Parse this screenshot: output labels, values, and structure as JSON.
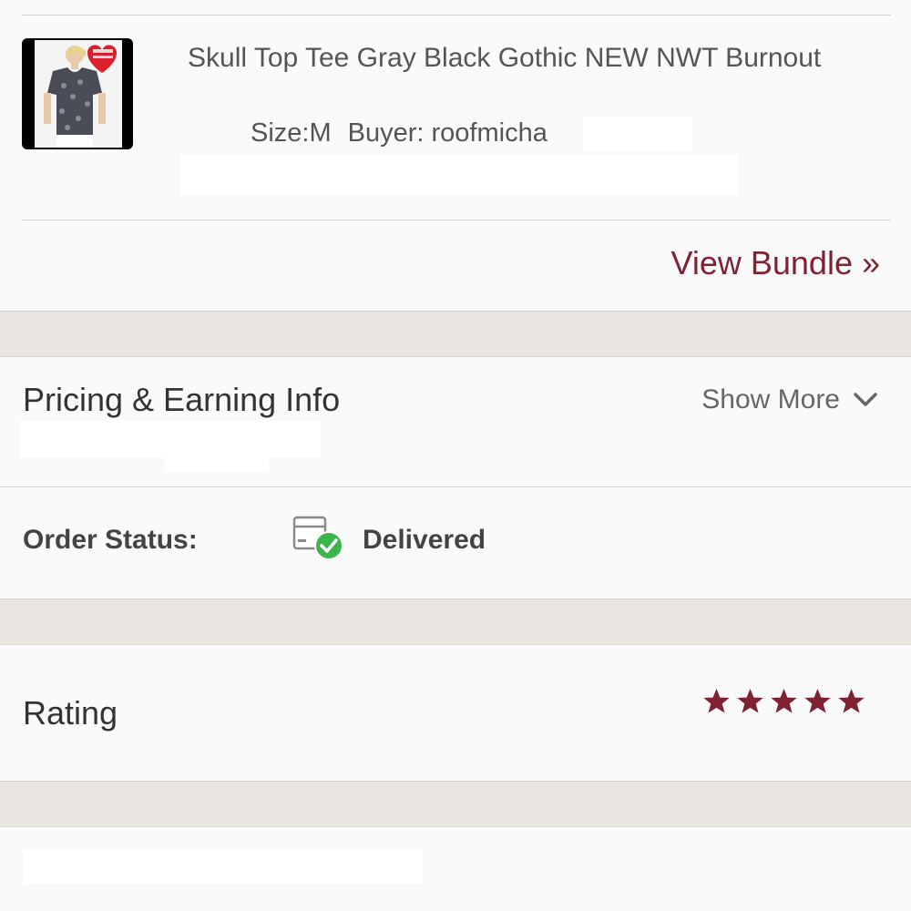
{
  "order": {
    "item": {
      "title": "Skull Top Tee Gray Black Gothic NEW NWT Burnout",
      "size": "Size:M",
      "buyer": "Buyer: roofmicha",
      "thumbnail": "shirt-photo"
    },
    "view_bundle_label": "View Bundle »"
  },
  "pricing": {
    "title": "Pricing & Earning Info",
    "show_more_label": "Show More",
    "show_more_icon": "chevron-down-icon"
  },
  "status": {
    "label": "Order Status:",
    "value": "Delivered",
    "icon": "package-delivered-icon",
    "icon_check_color": "#3cb54a"
  },
  "rating": {
    "title": "Rating",
    "stars": 5,
    "max_stars": 5,
    "star_color": "#7f2333"
  },
  "colors": {
    "accent": "#7f2333",
    "band": "#e9e6e2"
  }
}
